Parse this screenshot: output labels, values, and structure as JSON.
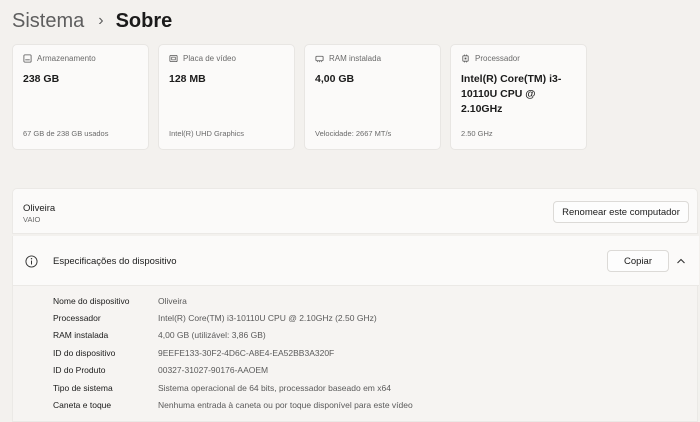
{
  "breadcrumb": {
    "parent": "Sistema",
    "separator": "›",
    "current": "Sobre"
  },
  "cards": [
    {
      "icon": "storage-icon",
      "title": "Armazenamento",
      "value": "238 GB",
      "sub": "67 GB de 238 GB usados"
    },
    {
      "icon": "gpu-icon",
      "title": "Placa de vídeo",
      "value": "128 MB",
      "sub": "Intel(R) UHD Graphics"
    },
    {
      "icon": "ram-icon",
      "title": "RAM instalada",
      "value": "4,00 GB",
      "sub": "Velocidade: 2667 MT/s"
    },
    {
      "icon": "cpu-icon",
      "title": "Processador",
      "value": "Intel(R) Core(TM) i3-10110U CPU @ 2.10GHz",
      "sub": "2.50 GHz"
    }
  ],
  "device": {
    "name": "Oliveira",
    "model": "VAIO",
    "rename_label": "Renomear este computador"
  },
  "specs": {
    "title": "Especificações do dispositivo",
    "copy_label": "Copiar",
    "rows": [
      {
        "label": "Nome do dispositivo",
        "value": "Oliveira"
      },
      {
        "label": "Processador",
        "value": "Intel(R) Core(TM) i3-10110U CPU @ 2.10GHz (2.50 GHz)"
      },
      {
        "label": "RAM instalada",
        "value": "4,00 GB (utilizável: 3,86 GB)"
      },
      {
        "label": "ID do dispositivo",
        "value": "9EEFE133-30F2-4D6C-A8E4-EA52BB3A320F"
      },
      {
        "label": "ID do Produto",
        "value": "00327-31027-90176-AAOEM"
      },
      {
        "label": "Tipo de sistema",
        "value": "Sistema operacional de 64 bits, processador baseado em x64"
      },
      {
        "label": "Caneta e toque",
        "value": "Nenhuma entrada à caneta ou por toque disponível para este vídeo"
      }
    ]
  }
}
